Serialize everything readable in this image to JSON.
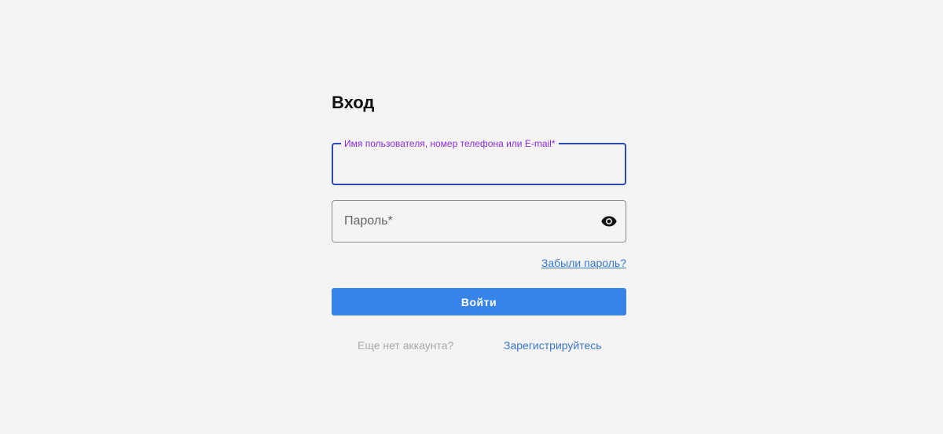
{
  "login": {
    "title": "Вход",
    "username_label": "Имя пользователя, номер телефона или E-mail*",
    "username_value": "",
    "password_placeholder": "Пароль*",
    "password_value": "",
    "forgot_link": "Забыли пароль?",
    "submit_label": "Войти",
    "no_account_text": "Еще нет аккаунта?",
    "register_link": "Зарегистрируйтесь"
  },
  "icons": {
    "password_toggle": "eye-icon"
  },
  "colors": {
    "background": "#f4f4f4",
    "active_border": "#2f49b3",
    "active_label": "#8a2be2",
    "primary_button": "#3883e8",
    "link": "#3a78c9",
    "muted_text": "#a9a9a9"
  }
}
